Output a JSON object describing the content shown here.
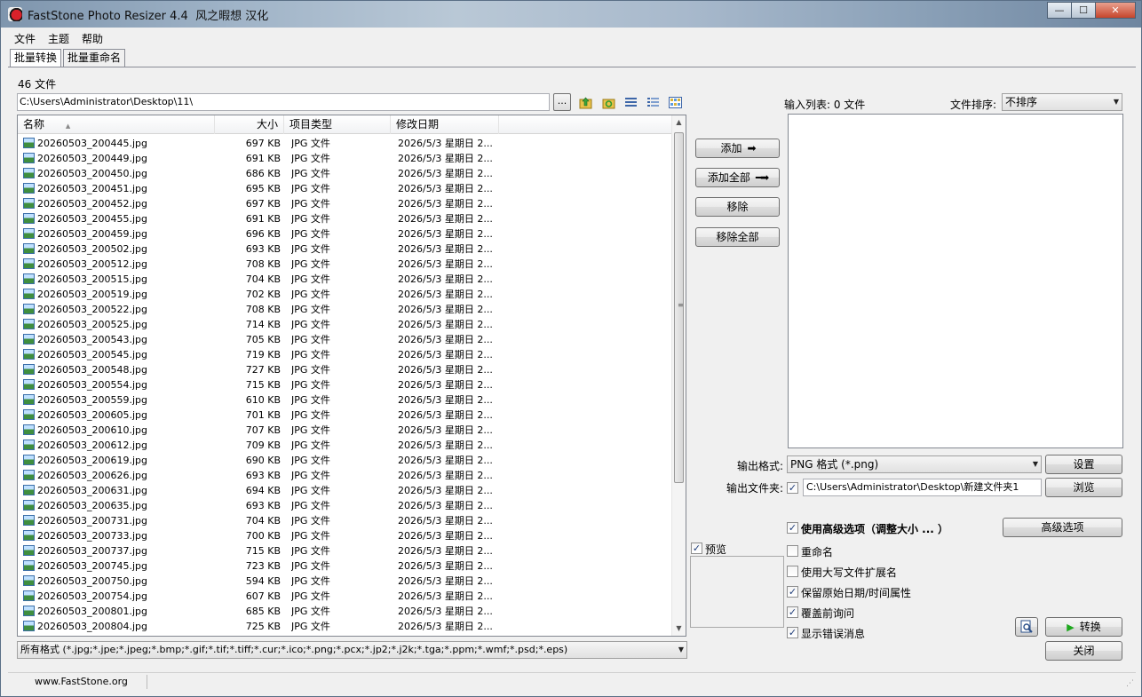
{
  "window": {
    "title": "FastStone Photo Resizer 4.4",
    "title_suffix": "风之暇想 汉化",
    "minimize": "—",
    "maximize": "☐",
    "close": "✕"
  },
  "menu": [
    "文件",
    "主题",
    "帮助"
  ],
  "tabs": [
    "批量转换",
    "批量重命名"
  ],
  "browser": {
    "file_count": "46 文件",
    "path": "C:\\Users\\Administrator\\Desktop\\11\\",
    "browse_label": "...",
    "columns": [
      "名称",
      "大小",
      "项目类型",
      "修改日期"
    ],
    "files": [
      {
        "name": "20260503_200445.jpg",
        "size": "697 KB",
        "type": "JPG 文件",
        "date": "2026/5/3 星期日 2..."
      },
      {
        "name": "20260503_200449.jpg",
        "size": "691 KB",
        "type": "JPG 文件",
        "date": "2026/5/3 星期日 2..."
      },
      {
        "name": "20260503_200450.jpg",
        "size": "686 KB",
        "type": "JPG 文件",
        "date": "2026/5/3 星期日 2..."
      },
      {
        "name": "20260503_200451.jpg",
        "size": "695 KB",
        "type": "JPG 文件",
        "date": "2026/5/3 星期日 2..."
      },
      {
        "name": "20260503_200452.jpg",
        "size": "697 KB",
        "type": "JPG 文件",
        "date": "2026/5/3 星期日 2..."
      },
      {
        "name": "20260503_200455.jpg",
        "size": "691 KB",
        "type": "JPG 文件",
        "date": "2026/5/3 星期日 2..."
      },
      {
        "name": "20260503_200459.jpg",
        "size": "696 KB",
        "type": "JPG 文件",
        "date": "2026/5/3 星期日 2..."
      },
      {
        "name": "20260503_200502.jpg",
        "size": "693 KB",
        "type": "JPG 文件",
        "date": "2026/5/3 星期日 2..."
      },
      {
        "name": "20260503_200512.jpg",
        "size": "708 KB",
        "type": "JPG 文件",
        "date": "2026/5/3 星期日 2..."
      },
      {
        "name": "20260503_200515.jpg",
        "size": "704 KB",
        "type": "JPG 文件",
        "date": "2026/5/3 星期日 2..."
      },
      {
        "name": "20260503_200519.jpg",
        "size": "702 KB",
        "type": "JPG 文件",
        "date": "2026/5/3 星期日 2..."
      },
      {
        "name": "20260503_200522.jpg",
        "size": "708 KB",
        "type": "JPG 文件",
        "date": "2026/5/3 星期日 2..."
      },
      {
        "name": "20260503_200525.jpg",
        "size": "714 KB",
        "type": "JPG 文件",
        "date": "2026/5/3 星期日 2..."
      },
      {
        "name": "20260503_200543.jpg",
        "size": "705 KB",
        "type": "JPG 文件",
        "date": "2026/5/3 星期日 2..."
      },
      {
        "name": "20260503_200545.jpg",
        "size": "719 KB",
        "type": "JPG 文件",
        "date": "2026/5/3 星期日 2..."
      },
      {
        "name": "20260503_200548.jpg",
        "size": "727 KB",
        "type": "JPG 文件",
        "date": "2026/5/3 星期日 2..."
      },
      {
        "name": "20260503_200554.jpg",
        "size": "715 KB",
        "type": "JPG 文件",
        "date": "2026/5/3 星期日 2..."
      },
      {
        "name": "20260503_200559.jpg",
        "size": "610 KB",
        "type": "JPG 文件",
        "date": "2026/5/3 星期日 2..."
      },
      {
        "name": "20260503_200605.jpg",
        "size": "701 KB",
        "type": "JPG 文件",
        "date": "2026/5/3 星期日 2..."
      },
      {
        "name": "20260503_200610.jpg",
        "size": "707 KB",
        "type": "JPG 文件",
        "date": "2026/5/3 星期日 2..."
      },
      {
        "name": "20260503_200612.jpg",
        "size": "709 KB",
        "type": "JPG 文件",
        "date": "2026/5/3 星期日 2..."
      },
      {
        "name": "20260503_200619.jpg",
        "size": "690 KB",
        "type": "JPG 文件",
        "date": "2026/5/3 星期日 2..."
      },
      {
        "name": "20260503_200626.jpg",
        "size": "693 KB",
        "type": "JPG 文件",
        "date": "2026/5/3 星期日 2..."
      },
      {
        "name": "20260503_200631.jpg",
        "size": "694 KB",
        "type": "JPG 文件",
        "date": "2026/5/3 星期日 2..."
      },
      {
        "name": "20260503_200635.jpg",
        "size": "693 KB",
        "type": "JPG 文件",
        "date": "2026/5/3 星期日 2..."
      },
      {
        "name": "20260503_200731.jpg",
        "size": "704 KB",
        "type": "JPG 文件",
        "date": "2026/5/3 星期日 2..."
      },
      {
        "name": "20260503_200733.jpg",
        "size": "700 KB",
        "type": "JPG 文件",
        "date": "2026/5/3 星期日 2..."
      },
      {
        "name": "20260503_200737.jpg",
        "size": "715 KB",
        "type": "JPG 文件",
        "date": "2026/5/3 星期日 2..."
      },
      {
        "name": "20260503_200745.jpg",
        "size": "723 KB",
        "type": "JPG 文件",
        "date": "2026/5/3 星期日 2..."
      },
      {
        "name": "20260503_200750.jpg",
        "size": "594 KB",
        "type": "JPG 文件",
        "date": "2026/5/3 星期日 2..."
      },
      {
        "name": "20260503_200754.jpg",
        "size": "607 KB",
        "type": "JPG 文件",
        "date": "2026/5/3 星期日 2..."
      },
      {
        "name": "20260503_200801.jpg",
        "size": "685 KB",
        "type": "JPG 文件",
        "date": "2026/5/3 星期日 2..."
      },
      {
        "name": "20260503_200804.jpg",
        "size": "725 KB",
        "type": "JPG 文件",
        "date": "2026/5/3 星期日 2..."
      }
    ],
    "filter": "所有格式 (*.jpg;*.jpe;*.jpeg;*.bmp;*.gif;*.tif;*.tiff;*.cur;*.ico;*.png;*.pcx;*.jp2;*.j2k;*.tga;*.ppm;*.wmf;*.psd;*.eps)"
  },
  "actions": {
    "add": "添加",
    "add_all": "添加全部",
    "remove": "移除",
    "remove_all": "移除全部",
    "preview": "预览",
    "preview_checked": true
  },
  "input_list": {
    "label": "输入列表: 0 文件",
    "sort_label": "文件排序:",
    "sort_value": "不排序"
  },
  "output": {
    "format_label": "输出格式:",
    "format_value": "PNG 格式 (*.png)",
    "settings": "设置",
    "folder_label": "输出文件夹:",
    "folder_checked": true,
    "folder_value": "C:\\Users\\Administrator\\Desktop\\新建文件夹1",
    "browse": "浏览"
  },
  "options": {
    "advanced": {
      "label": "使用高级选项（调整大小 ... ）",
      "checked": true
    },
    "advanced_button": "高级选项",
    "items": [
      {
        "label": "重命名",
        "checked": false
      },
      {
        "label": "使用大写文件扩展名",
        "checked": false
      },
      {
        "label": "保留原始日期/时间属性",
        "checked": true
      },
      {
        "label": "覆盖前询问",
        "checked": true
      },
      {
        "label": "显示错误消息",
        "checked": true
      }
    ],
    "convert": "转换",
    "close": "关闭"
  },
  "status": {
    "url": "www.FastStone.org"
  }
}
